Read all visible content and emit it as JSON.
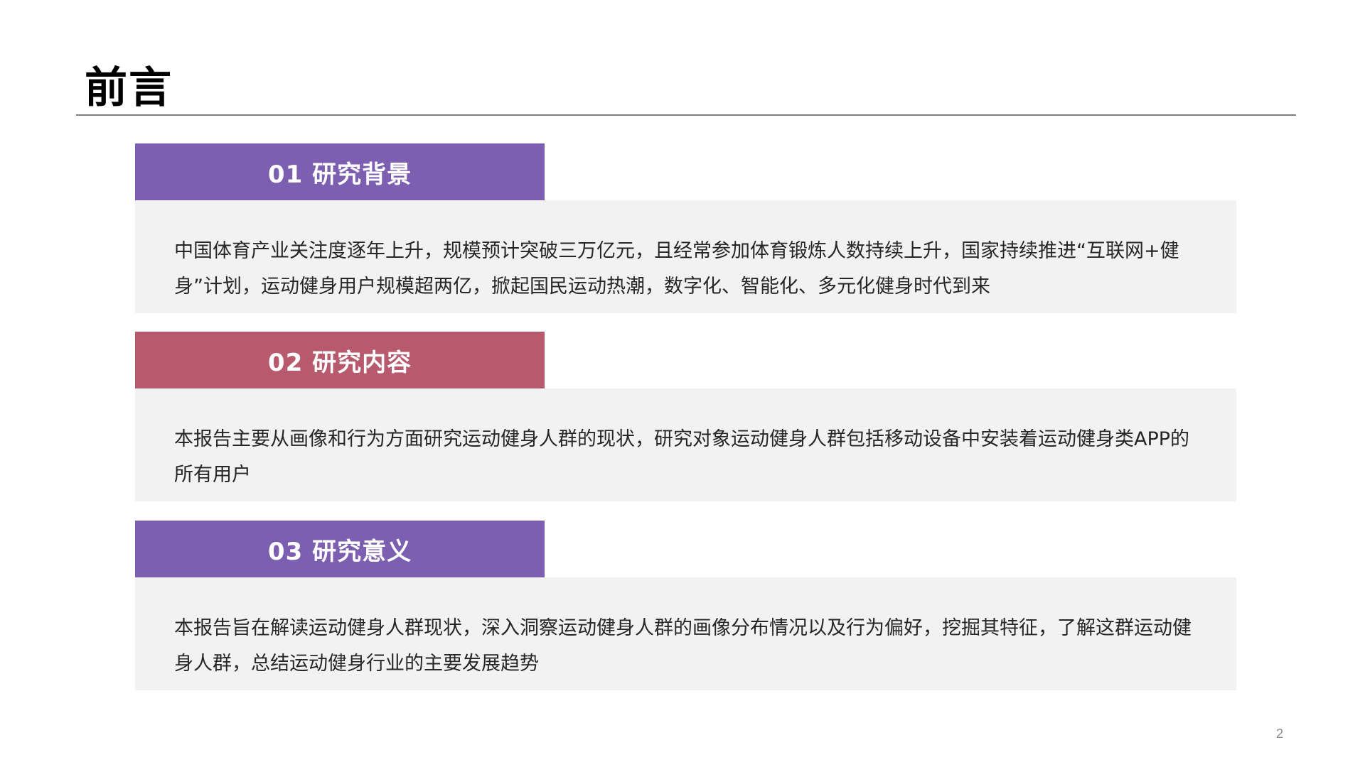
{
  "page": {
    "title": "前言",
    "page_number": "2"
  },
  "sections": [
    {
      "header": "01 研究背景",
      "body": "中国体育产业关注度逐年上升，规模预计突破三万亿元，且经常参加体育锻炼人数持续上升，国家持续推进“互联网+健身”计划，运动健身用户规模超两亿，掀起国民运动热潮，数字化、智能化、多元化健身时代到来",
      "header_color": "#7d5fb2"
    },
    {
      "header": "02 研究内容",
      "body": "本报告主要从画像和行为方面研究运动健身人群的现状，研究对象运动健身人群包括移动设备中安装着运动健身类APP的所有用户",
      "header_color": "#b85a6e"
    },
    {
      "header": "03 研究意义",
      "body": "本报告旨在解读运动健身人群现状，深入洞察运动健身人群的画像分布情况以及行为偏好，挖掘其特征，了解这群运动健身人群，总结运动健身行业的主要发展趋势",
      "header_color": "#7d5fb2"
    }
  ]
}
